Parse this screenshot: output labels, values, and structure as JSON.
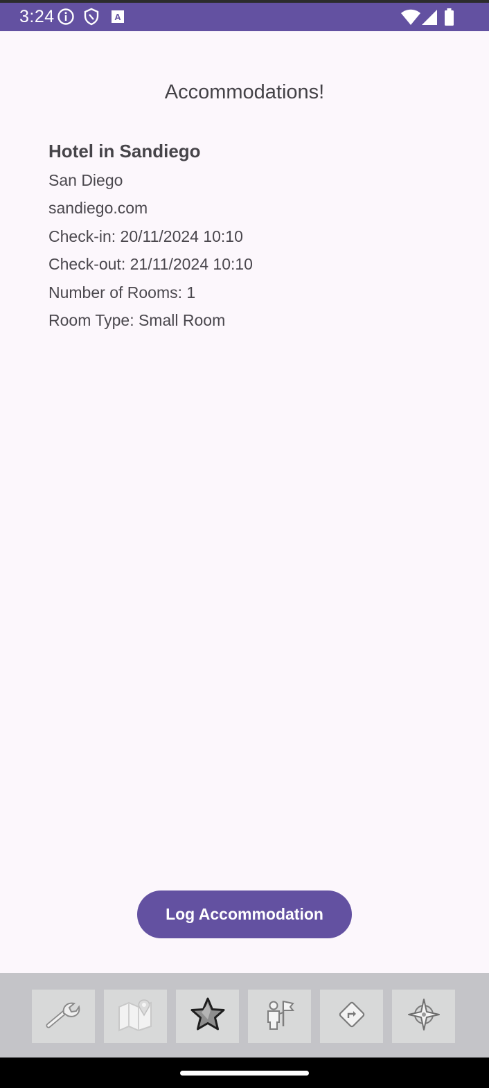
{
  "status_bar": {
    "time": "3:24",
    "icons_left": [
      "info-icon",
      "shield-icon",
      "a-badge-icon"
    ],
    "icons_right": [
      "wifi-icon",
      "signal-icon",
      "battery-icon"
    ],
    "color": "#6351a1"
  },
  "screen": {
    "title": "Accommodations!"
  },
  "accommodation": {
    "name": "Hotel in Sandiego",
    "city": "San Diego",
    "website": "sandiego.com",
    "check_in": "Check-in: 20/11/2024 10:10",
    "check_out": "Check-out: 21/11/2024 10:10",
    "rooms": "Number of Rooms: 1",
    "room_type": "Room Type: Small Room"
  },
  "actions": {
    "log_label": "Log Accommodation",
    "accent": "#6351a1"
  },
  "bottom_nav": {
    "items": [
      {
        "icon": "wrench-icon"
      },
      {
        "icon": "map-icon"
      },
      {
        "icon": "star-icon",
        "selected": true
      },
      {
        "icon": "tour-guide-icon"
      },
      {
        "icon": "directions-icon"
      },
      {
        "icon": "compass-icon"
      }
    ]
  }
}
